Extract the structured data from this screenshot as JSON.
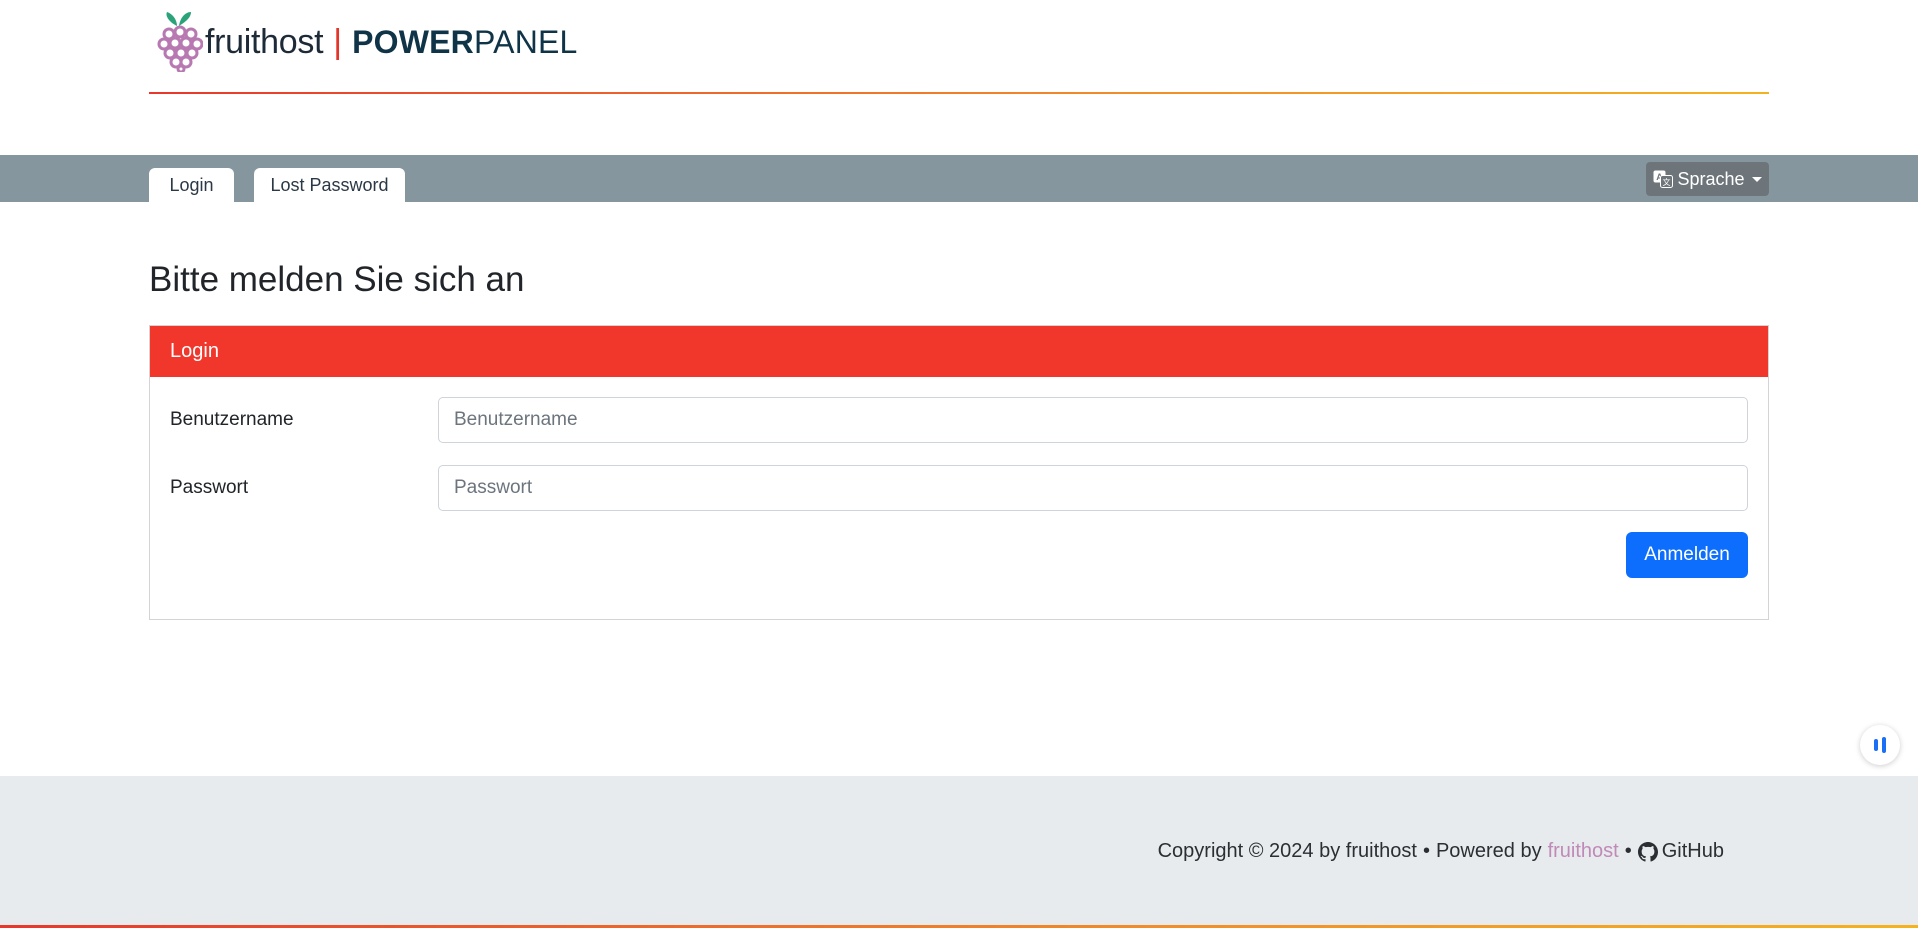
{
  "header": {
    "brand": "fruithost",
    "separator": "|",
    "power": "POWER",
    "panel": "PANEL",
    "logo_icon": "grape-icon"
  },
  "nav": {
    "tabs": [
      {
        "label": "Login"
      },
      {
        "label": "Lost Password"
      }
    ],
    "language_button": {
      "label": "Sprache",
      "icon": "translate-icon"
    }
  },
  "main": {
    "title": "Bitte melden Sie sich an",
    "card": {
      "header": "Login",
      "username": {
        "label": "Benutzername",
        "placeholder": "Benutzername",
        "value": ""
      },
      "password": {
        "label": "Passwort",
        "placeholder": "Passwort",
        "value": ""
      },
      "submit_label": "Anmelden"
    }
  },
  "footer": {
    "copyright": "Copyright © 2024 by fruithost",
    "bullet": "•",
    "powered_by": "Powered by",
    "powered_link": "fruithost",
    "github_label": "GitHub"
  },
  "colors": {
    "accent_red": "#f1372b",
    "primary_blue": "#0d6efd",
    "navbar_gray": "#85969e",
    "link_purple": "#c08ab8"
  }
}
